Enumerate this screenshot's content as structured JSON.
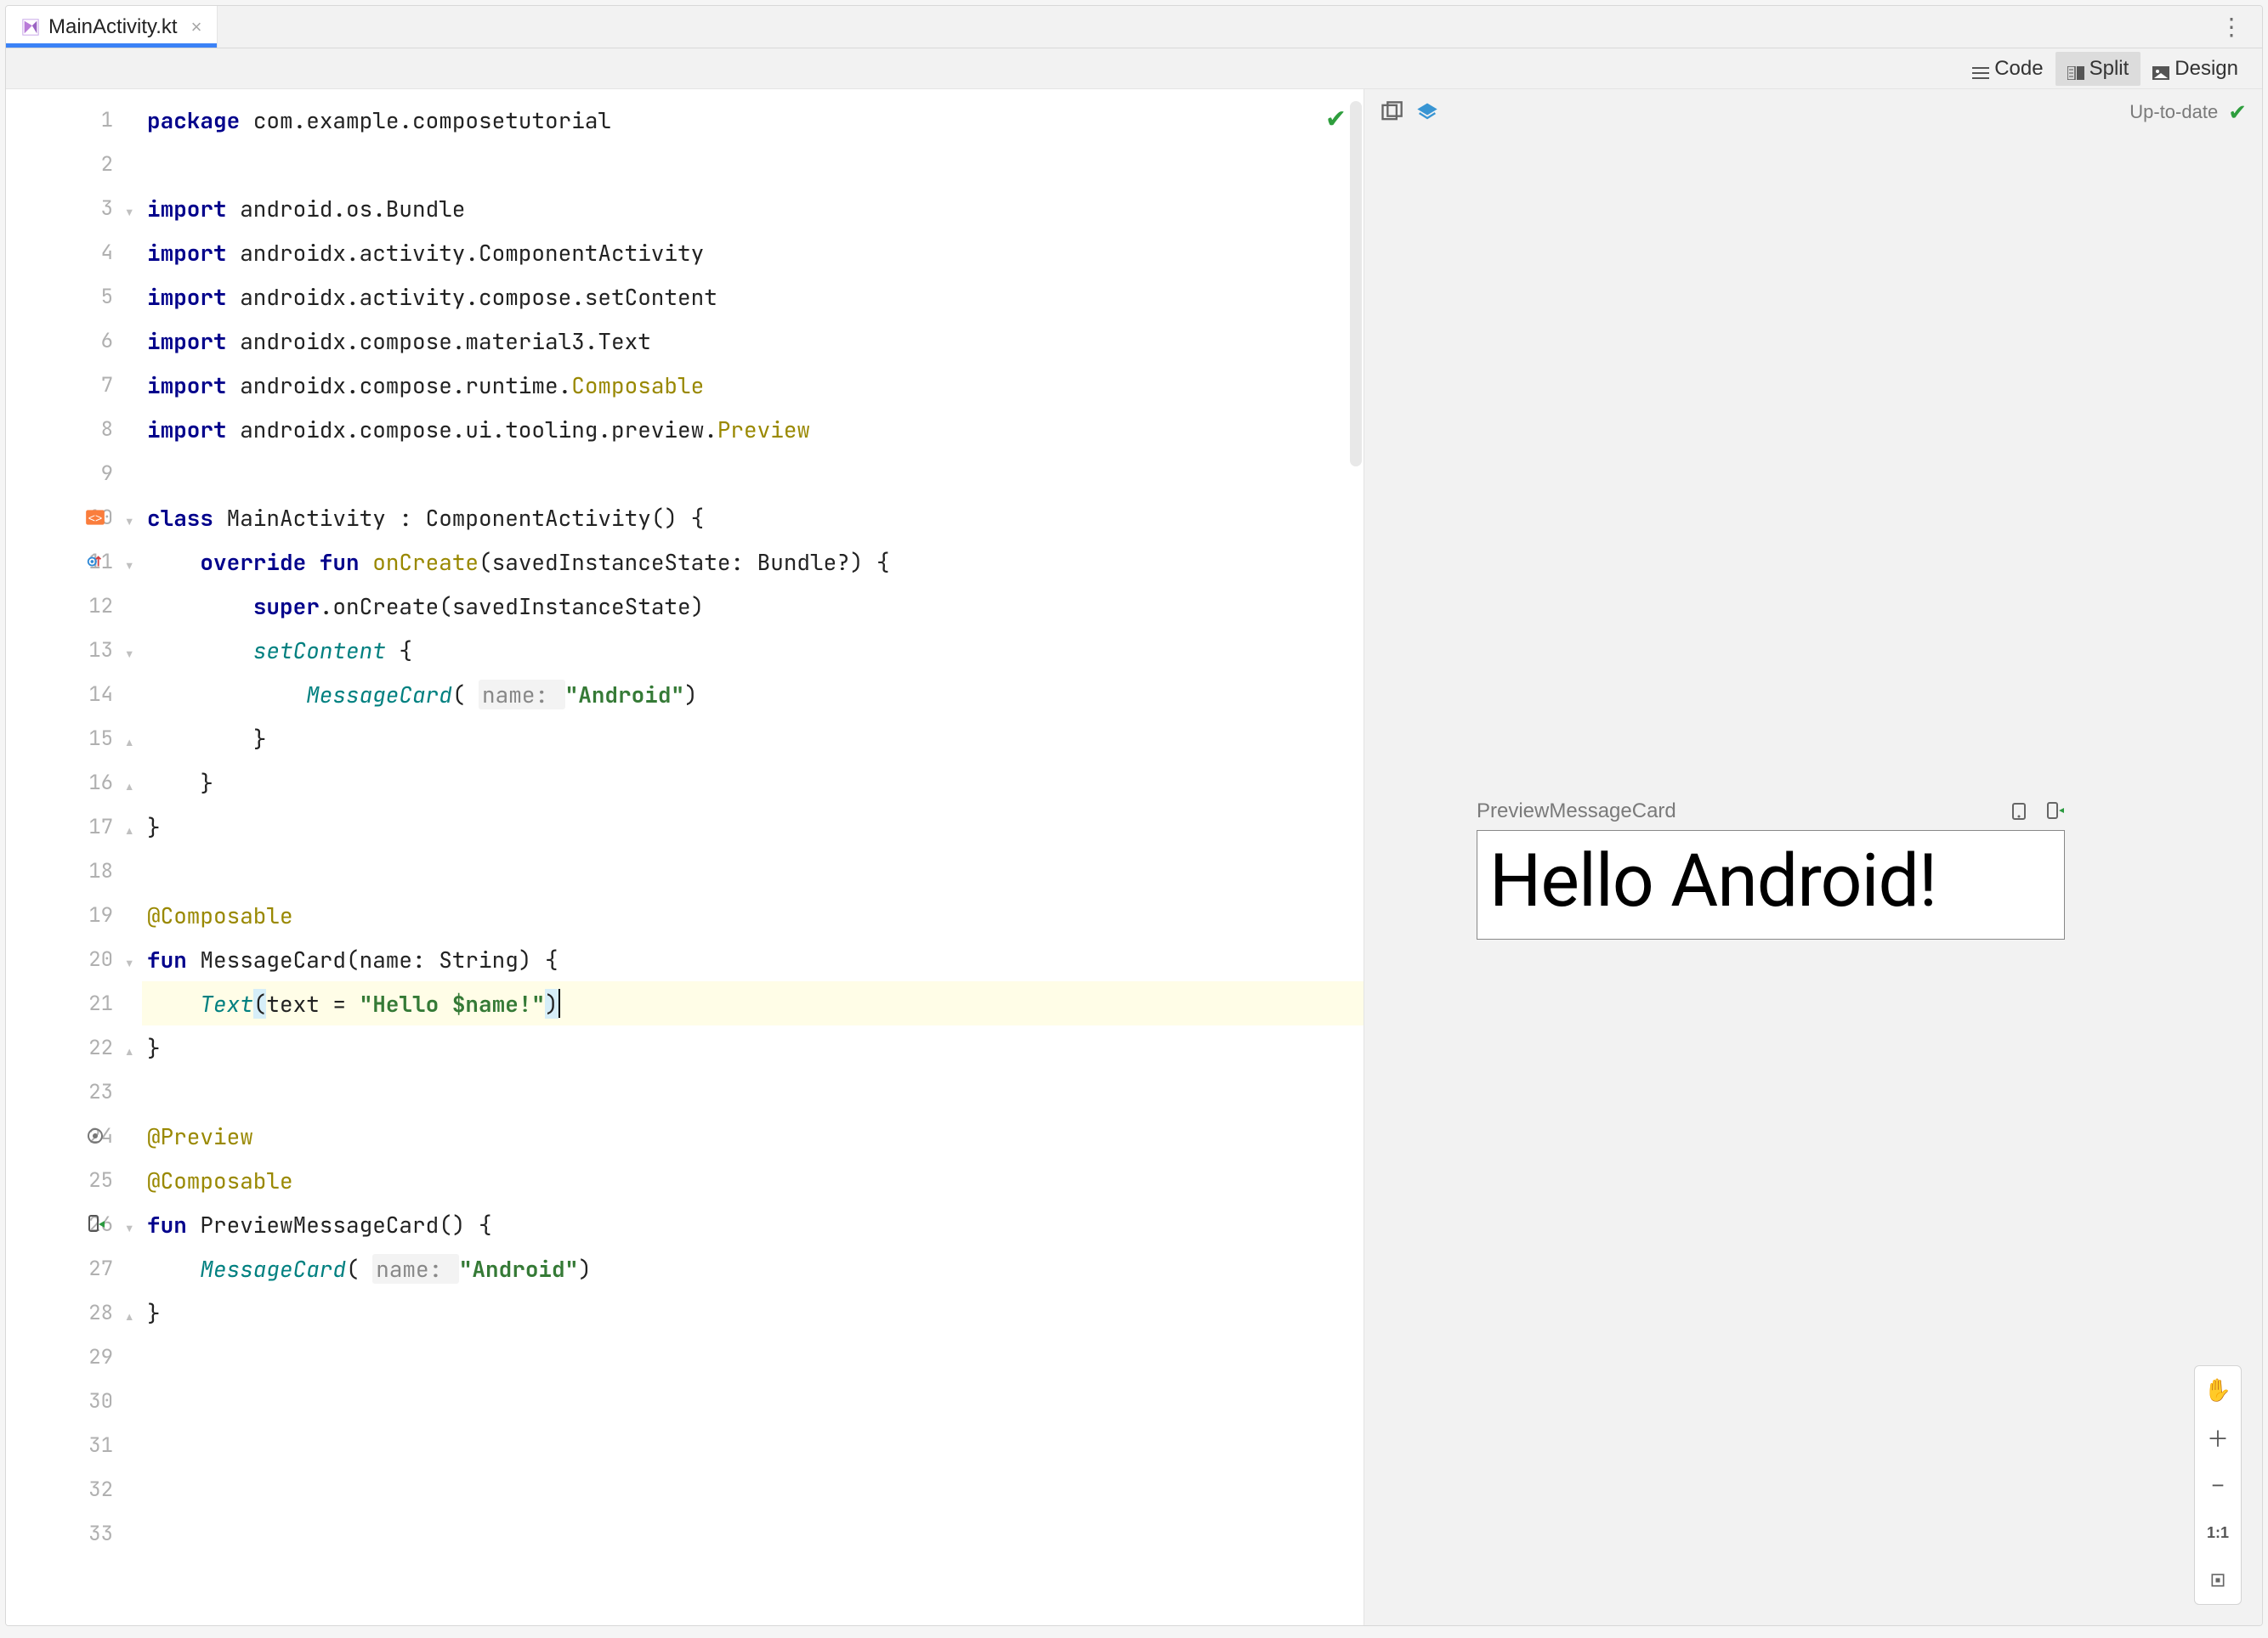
{
  "tab": {
    "file_name": "MainActivity.kt"
  },
  "view_modes": {
    "code": "Code",
    "split": "Split",
    "design": "Design"
  },
  "lines": {
    "l1": {
      "t1": "package ",
      "t2": "com.example.composetutorial"
    },
    "l3": {
      "t1": "import ",
      "t2": "android.os.Bundle"
    },
    "l4": {
      "t1": "import ",
      "t2": "androidx.activity.ComponentActivity"
    },
    "l5": {
      "t1": "import ",
      "t2": "androidx.activity.compose.setContent"
    },
    "l6": {
      "t1": "import ",
      "t2": "androidx.compose.material3.Text"
    },
    "l7": {
      "t1": "import ",
      "t2": "androidx.compose.runtime.",
      "t3": "Composable"
    },
    "l8": {
      "t1": "import ",
      "t2": "androidx.compose.ui.tooling.preview.",
      "t3": "Preview"
    },
    "l10": {
      "t1": "class ",
      "t2": "MainActivity : ComponentActivity() {"
    },
    "l11": {
      "pad": "    ",
      "t1": "override fun ",
      "fn": "onCreate",
      "t2": "(savedInstanceState: Bundle?) {"
    },
    "l12": {
      "pad": "        ",
      "t1": "super",
      "t2": ".onCreate(savedInstanceState)"
    },
    "l13": {
      "pad": "        ",
      "fn": "setContent",
      "t2": " {"
    },
    "l14": {
      "pad": "            ",
      "fn": "MessageCard",
      "open": "( ",
      "hint": "name: ",
      "str": "\"Android\"",
      "close": ")"
    },
    "l15": {
      "pad": "        ",
      "t": "}"
    },
    "l16": {
      "pad": "    ",
      "t": "}"
    },
    "l17": {
      "t": "}"
    },
    "l19": {
      "t": "@Composable"
    },
    "l20": {
      "t1": "fun ",
      "t2": "MessageCard(name: String) {"
    },
    "l21": {
      "pad": "    ",
      "fn": "Text",
      "open": "(",
      "arg": "text = ",
      "str": "\"Hello $name!\"",
      "close": ")"
    },
    "l22": {
      "t": "}"
    },
    "l24": {
      "t": "@Preview"
    },
    "l25": {
      "t": "@Composable"
    },
    "l26": {
      "t1": "fun ",
      "t2": "PreviewMessageCard() {"
    },
    "l27": {
      "pad": "    ",
      "fn": "MessageCard",
      "open": "( ",
      "hint": "name: ",
      "str": "\"Android\"",
      "close": ")"
    },
    "l28": {
      "t": "}"
    }
  },
  "line_nums": [
    "1",
    "2",
    "3",
    "4",
    "5",
    "6",
    "7",
    "8",
    "9",
    "10",
    "11",
    "12",
    "13",
    "14",
    "15",
    "16",
    "17",
    "18",
    "19",
    "20",
    "21",
    "22",
    "23",
    "24",
    "25",
    "26",
    "27",
    "28",
    "29",
    "30",
    "31",
    "32",
    "33"
  ],
  "preview": {
    "status": "Up-to-date",
    "composable_name": "PreviewMessageCard",
    "render_text": "Hello Android!"
  },
  "zoom": {
    "one_to_one": "1:1"
  }
}
